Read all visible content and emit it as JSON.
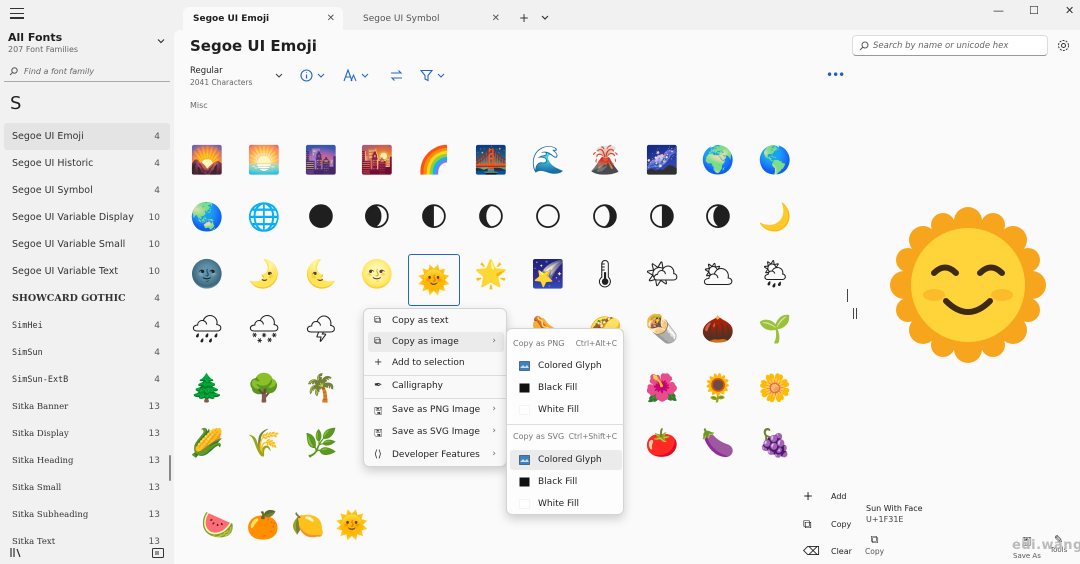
{
  "sidebar": {
    "title": "All Fonts",
    "subtitle": "207 Font Families",
    "search_placeholder": "Find a font family",
    "letter": "S",
    "fonts": [
      {
        "name": "Segoe UI Emoji",
        "count": "4",
        "selected": true
      },
      {
        "name": "Segoe UI Historic",
        "count": "4"
      },
      {
        "name": "Segoe UI Symbol",
        "count": "4"
      },
      {
        "name": "Segoe UI Variable Display",
        "count": "10"
      },
      {
        "name": "Segoe UI Variable Small",
        "count": "10"
      },
      {
        "name": "Segoe UI Variable Text",
        "count": "10"
      },
      {
        "name": "SHOWCARD GOTHIC",
        "count": "4"
      },
      {
        "name": "SimHei",
        "count": "4"
      },
      {
        "name": "SimSun",
        "count": "4"
      },
      {
        "name": "SimSun-ExtB",
        "count": "4"
      },
      {
        "name": "Sitka Banner",
        "count": "13"
      },
      {
        "name": "Sitka Display",
        "count": "13"
      },
      {
        "name": "Sitka Heading",
        "count": "13"
      },
      {
        "name": "Sitka Small",
        "count": "13"
      },
      {
        "name": "Sitka Subheading",
        "count": "13"
      },
      {
        "name": "Sitka Text",
        "count": "13"
      }
    ]
  },
  "tabs": [
    {
      "label": "Segoe UI Emoji",
      "active": true
    },
    {
      "label": "Segoe UI Symbol",
      "active": false
    }
  ],
  "header": {
    "font_title": "Segoe UI Emoji",
    "style_name": "Regular",
    "char_count": "2041 Characters",
    "category": "Misc"
  },
  "glyphs": [
    "🌄",
    "🌅",
    "🌆",
    "🌇",
    "🌈",
    "🌉",
    "🌊",
    "🌋",
    "🌌",
    "🌍",
    "🌎",
    "🌏",
    "🌐",
    "🌑",
    "🌒",
    "🌓",
    "🌔",
    "🌕",
    "🌖",
    "🌗",
    "🌘",
    "🌙",
    "🌚",
    "🌛",
    "🌜",
    "🌝",
    "🌞",
    "🌟",
    "🌠",
    "🌡",
    "🌤",
    "🌥",
    "🌦",
    "🌧",
    "🌨",
    "🌩",
    "🌪",
    "🌫",
    "🌬",
    "🌭",
    "🌮",
    "🌯",
    "🌰",
    "🌱",
    "🌲",
    "🌳",
    "🌴",
    "🌵",
    "🌶",
    "🌷",
    "🌸",
    "🌹",
    "🌺",
    "🌻",
    "🌼",
    "🌽",
    "🌾",
    "🌿",
    "🍀",
    "🍁",
    "🍂",
    "🍃",
    "🍄",
    "🍅",
    "🍆",
    "🍇",
    "🍉",
    "🍊",
    "🍋",
    "🌞"
  ],
  "context_menu": {
    "items": [
      {
        "label": "Copy as text",
        "icon": "copy-icon"
      },
      {
        "label": "Copy as image",
        "icon": "copy-image-icon",
        "submenu": true,
        "highlighted": true
      },
      {
        "label": "Add to selection",
        "icon": "plus-icon"
      },
      {
        "label": "Calligraphy",
        "icon": "pen-icon"
      },
      {
        "label": "Save as PNG Image",
        "icon": "save-icon",
        "submenu": true
      },
      {
        "label": "Save as SVG Image",
        "icon": "save-icon",
        "submenu": true
      },
      {
        "label": "Developer Features",
        "icon": "code-icon",
        "submenu": true
      }
    ]
  },
  "submenu": {
    "png_header": "Copy as PNG",
    "png_shortcut": "Ctrl+Alt+C",
    "svg_header": "Copy as SVG",
    "svg_shortcut": "Ctrl+Shift+C",
    "png_items": [
      "Colored Glyph",
      "Black Fill",
      "White Fill"
    ],
    "svg_items": [
      "Colored Glyph",
      "Black Fill",
      "White Fill"
    ]
  },
  "right_panel": {
    "search_placeholder": "Search by name or unicode hex",
    "preview_glyph": "🌞",
    "actions": {
      "add": "Add",
      "copy": "Copy",
      "clear": "Clear"
    },
    "glyph_name": "Sun With Face",
    "glyph_code": "U+1F31E",
    "copy_label": "Copy",
    "save_as_label": "Save As",
    "tools_label": "Tools",
    "watermark": "edi.wang"
  },
  "colors": {
    "accent": "#2166c9",
    "sun_petals": "#F7A51D",
    "sun_face": "#FFD43B"
  }
}
